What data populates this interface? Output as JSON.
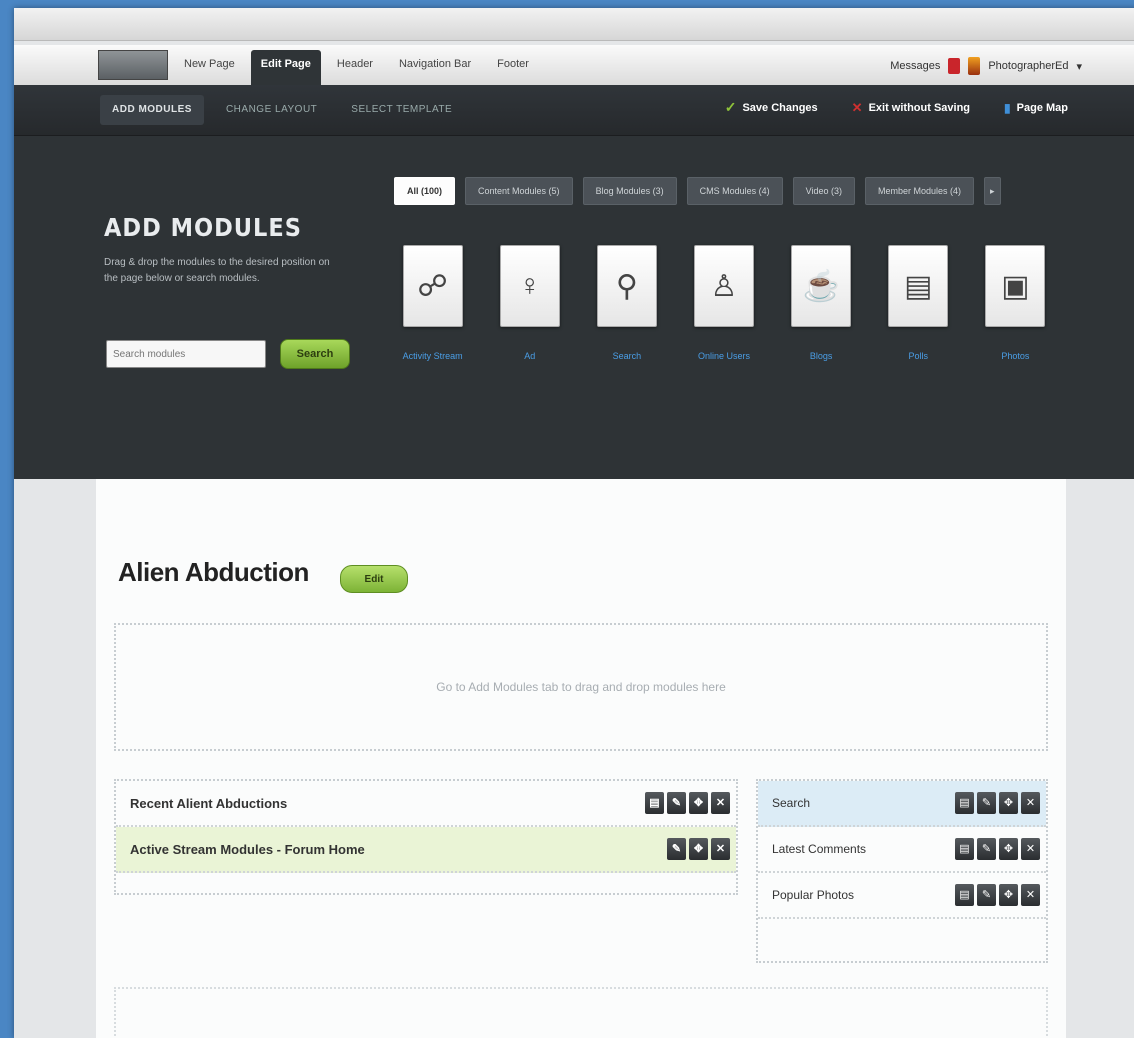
{
  "window": {
    "title": ""
  },
  "topmenu": {
    "logo_label": "",
    "tabs": [
      "New Page",
      "Edit Page",
      "Header",
      "Navigation Bar",
      "Footer"
    ],
    "messages_label": "Messages",
    "user_label": "PhotographerEd"
  },
  "subnav": {
    "tabs": [
      "ADD MODULES",
      "CHANGE LAYOUT",
      "SELECT TEMPLATE"
    ],
    "actions": [
      "Save Changes",
      "Exit without Saving",
      "Page Map"
    ]
  },
  "add_modules": {
    "title": "ADD MODULES",
    "description": "Drag & drop the modules to the desired position on the page below or search modules.",
    "search_placeholder": "Search modules",
    "search_button": "Search"
  },
  "filters": [
    "All (100)",
    "Content Modules (5)",
    "Blog Modules (3)",
    "CMS Modules (4)",
    "Video (3)",
    "Member Modules (4)"
  ],
  "modules": [
    {
      "label": "Activity Stream",
      "icon": "chat-bubbles-icon",
      "glyph": "☍"
    },
    {
      "label": "Ad",
      "icon": "tie-icon",
      "glyph": "♀"
    },
    {
      "label": "Search",
      "icon": "magnifier-icon",
      "glyph": "⚲"
    },
    {
      "label": "Online Users",
      "icon": "user-icon",
      "glyph": "♙"
    },
    {
      "label": "Blogs",
      "icon": "coffee-icon",
      "glyph": "☕"
    },
    {
      "label": "Polls",
      "icon": "poll-icon",
      "glyph": "▤"
    },
    {
      "label": "Photos",
      "icon": "photo-icon",
      "glyph": "▣"
    }
  ],
  "page": {
    "title": "Alien Abduction",
    "edit_button": "Edit",
    "dropzone_text": "Go to Add Modules tab to drag and drop modules here",
    "left_rows": [
      {
        "label": "Recent Alient Abductions",
        "controls": [
          "▤",
          "✎",
          "✥",
          "✕"
        ]
      },
      {
        "label": "Active Stream Modules - Forum Home",
        "controls": [
          "✎",
          "✥",
          "✕"
        ]
      }
    ],
    "right_rows": [
      {
        "label": "Search",
        "controls": [
          "▤",
          "✎",
          "✥",
          "✕"
        ]
      },
      {
        "label": "Latest Comments",
        "controls": [
          "▤",
          "✎",
          "✥",
          "✕"
        ]
      },
      {
        "label": "Popular Photos",
        "controls": [
          "▤",
          "✎",
          "✥",
          "✕"
        ]
      }
    ]
  },
  "colors": {
    "panel": "#2e3336",
    "accent_green": "#8fc33a",
    "link_blue": "#4a9ee6"
  }
}
